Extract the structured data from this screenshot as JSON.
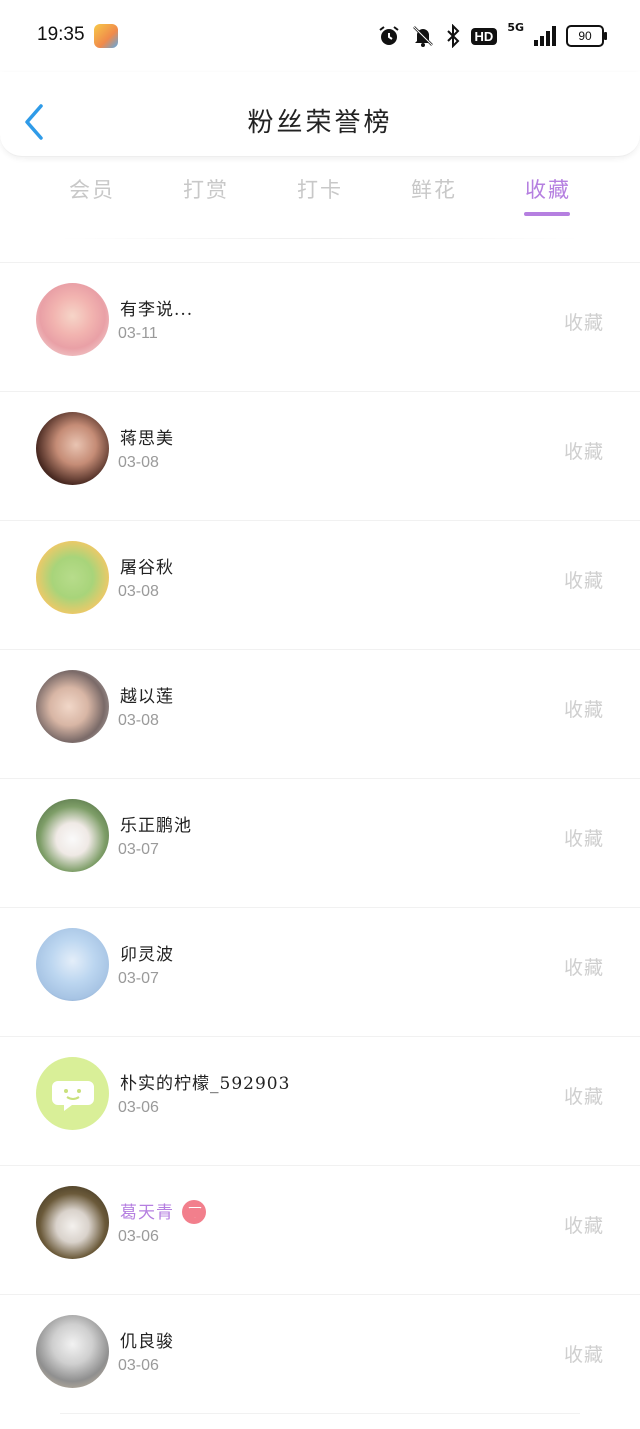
{
  "status_bar": {
    "time": "19:35",
    "hd_label": "HD",
    "net_label": "5G",
    "battery": "90",
    "icons": [
      "app-icon",
      "alarm-icon",
      "mute-icon",
      "bluetooth-icon",
      "hd-icon",
      "signal-icon",
      "battery-icon"
    ]
  },
  "header": {
    "title": "粉丝荣誉榜",
    "back_icon": "chevron-left-icon"
  },
  "tabs": [
    {
      "label": "会员",
      "active": false
    },
    {
      "label": "打赏",
      "active": false
    },
    {
      "label": "打卡",
      "active": false
    },
    {
      "label": "鲜花",
      "active": false
    },
    {
      "label": "收藏",
      "active": true
    }
  ],
  "list": [
    {
      "name": "有李说...",
      "date": "03-11",
      "action": "收藏"
    },
    {
      "name": "蒋思美",
      "date": "03-08",
      "action": "收藏"
    },
    {
      "name": "屠谷秋",
      "date": "03-08",
      "action": "收藏"
    },
    {
      "name": "越以莲",
      "date": "03-08",
      "action": "收藏"
    },
    {
      "name": "乐正鹏池",
      "date": "03-07",
      "action": "收藏"
    },
    {
      "name": "卯灵波",
      "date": "03-07",
      "action": "收藏"
    },
    {
      "name": "朴实的柠檬_592903",
      "date": "03-06",
      "action": "收藏"
    },
    {
      "name": "葛天青",
      "date": "03-06",
      "action": "收藏",
      "vip": true
    },
    {
      "name": "仉良骏",
      "date": "03-06",
      "action": "收藏"
    }
  ],
  "colors": {
    "accent": "#b57fe0",
    "back_arrow": "#2f9be8",
    "inactive_tab": "#c8c8c8",
    "vip_badge": "#f27f8c"
  }
}
